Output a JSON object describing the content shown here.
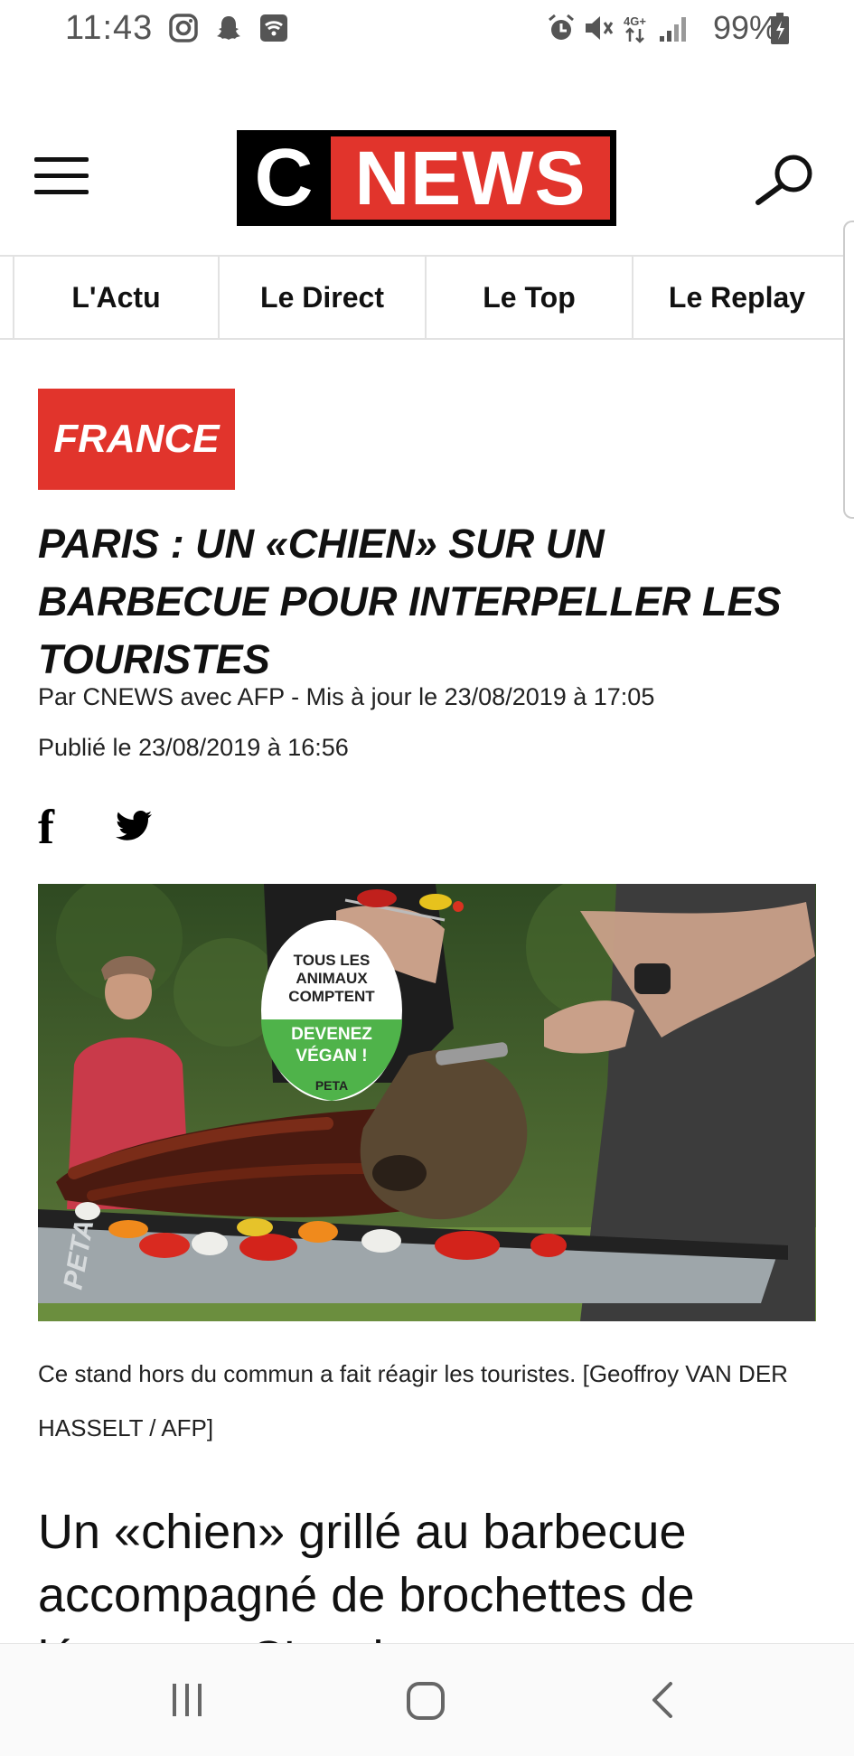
{
  "status_bar": {
    "time": "11:43",
    "battery": "99%",
    "left_icons": [
      "instagram-icon",
      "snapchat-icon",
      "wifi-icon"
    ],
    "right_icons": [
      "alarm-icon",
      "mute-icon",
      "4g-icon",
      "signal-icon",
      "battery-icon"
    ]
  },
  "header": {
    "logo_c": "C",
    "logo_news": "NEWS",
    "logo_accent": "#e1342c"
  },
  "tabs": [
    {
      "label": "L'Actu"
    },
    {
      "label": "Le Direct"
    },
    {
      "label": "Le Top"
    },
    {
      "label": "Le Replay"
    }
  ],
  "article": {
    "category": "FRANCE",
    "headline": "PARIS : UN «CHIEN» SUR UN BARBECUE POUR INTERPELLER LES TOURISTES",
    "byline": "Par CNEWS avec AFP - Mis à jour le 23/08/2019 à 17:05",
    "published": "Publié le 23/08/2019 à 16:56",
    "photo": {
      "sign_lines": [
        "TOUS LES",
        "ANIMAUX",
        "COMPTENT"
      ],
      "sign_green_lines": [
        "DEVENEZ",
        "VÉGAN !"
      ],
      "sign_brand": "PETA",
      "grill_brand": "PETA"
    },
    "caption": "Ce stand hors du commun a fait réagir les touristes. [Geoffroy VAN DER HASSELT / AFP]",
    "lead": "Un «chien» grillé au barbecue accompagné de brochettes de légumes. C'est le"
  },
  "social": {
    "facebook_glyph": "f"
  }
}
